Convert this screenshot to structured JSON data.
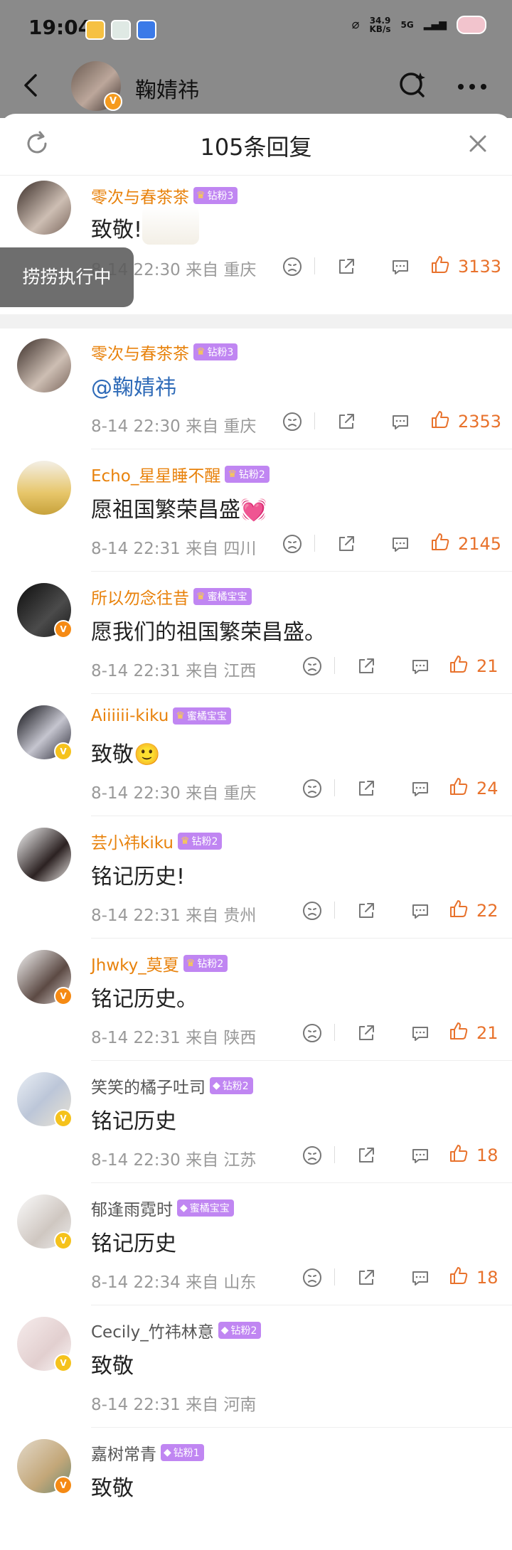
{
  "status_bar": {
    "time": "19:04",
    "net_speed_value": "34.9",
    "net_speed_unit": "KB/s",
    "signal": "5G",
    "icons": [
      "weibo-icon",
      "app-icon",
      "message-icon",
      "nfc-icon",
      "battery-icon"
    ]
  },
  "header": {
    "name": "鞠婧祎"
  },
  "sheet": {
    "title": "105条回复"
  },
  "toast": "捞捞执行中",
  "colors": {
    "accent": "#e8722c",
    "username": "#e8820c",
    "fan_badge": "#c086f2",
    "mention": "#2f6bb8"
  },
  "original_comment": {
    "user": "零次与春茶茶",
    "fan": "钻粉3",
    "text": "致敬!",
    "time": "8-14 22:30",
    "from": "来自 重庆",
    "likes": "3133"
  },
  "comments": [
    {
      "user": "零次与春茶茶",
      "fan": "钻粉3",
      "text": "@鞠婧祎",
      "time": "8-14 22:30",
      "from": "来自 重庆",
      "likes": "2353"
    },
    {
      "user": "Echo_星星睡不醒",
      "fan": "钻粉2",
      "text": "愿祖国繁荣昌盛💓",
      "time": "8-14 22:31",
      "from": "来自 四川",
      "likes": "2145"
    },
    {
      "user": "所以勿念往昔",
      "fan": "蜜橘宝宝",
      "text": "愿我们的祖国繁荣昌盛。",
      "time": "8-14 22:31",
      "from": "来自 江西",
      "likes": "21"
    },
    {
      "user": "Aiiiiii-kiku",
      "fan": "蜜橘宝宝",
      "text": "致敬🙂",
      "time": "8-14 22:30",
      "from": "来自 重庆",
      "likes": "24"
    },
    {
      "user": "芸小祎kiku",
      "fan": "钻粉2",
      "text": "铭记历史!",
      "time": "8-14 22:31",
      "from": "来自 贵州",
      "likes": "22"
    },
    {
      "user": "Jhwky_莫夏",
      "fan": "钻粉2",
      "text": "铭记历史。",
      "time": "8-14 22:31",
      "from": "来自 陕西",
      "likes": "21"
    },
    {
      "user": "笑笑的橘子吐司",
      "fan": "钻粉2",
      "text": "铭记历史",
      "time": "8-14 22:30",
      "from": "来自 江苏",
      "likes": "18"
    },
    {
      "user": "郁逢雨霓时",
      "fan": "蜜橘宝宝",
      "text": "铭记历史",
      "time": "8-14 22:34",
      "from": "来自 山东",
      "likes": "18"
    },
    {
      "user": "Cecily_竹祎林意",
      "fan": "钻粉2",
      "text": "致敬",
      "time": "8-14 22:31",
      "from": "来自 河南",
      "likes": ""
    },
    {
      "user": "嘉树常青",
      "fan": "钻粉1",
      "text": "致敬",
      "time": "",
      "from": "",
      "likes": ""
    }
  ]
}
